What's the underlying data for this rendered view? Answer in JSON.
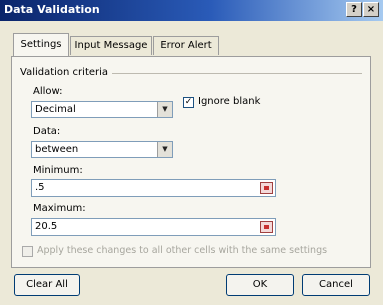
{
  "window": {
    "title": "Data Validation",
    "help_glyph": "?",
    "close_glyph": "×"
  },
  "tabs": [
    {
      "label": "Settings",
      "active": true
    },
    {
      "label": "Input Message",
      "active": false
    },
    {
      "label": "Error Alert",
      "active": false
    }
  ],
  "criteria": {
    "group_label": "Validation criteria",
    "allow_label": "Allow:",
    "allow_value": "Decimal",
    "ignore_blank_label": "Ignore blank",
    "ignore_blank_checked": true,
    "data_label": "Data:",
    "data_value": "between",
    "minimum_label": "Minimum:",
    "minimum_value": ".5",
    "maximum_label": "Maximum:",
    "maximum_value": "20.5"
  },
  "apply_all": {
    "label": "Apply these changes to all other cells with the same settings",
    "checked": false,
    "enabled": false
  },
  "buttons": {
    "clear_all": "Clear All",
    "ok": "OK",
    "cancel": "Cancel"
  }
}
